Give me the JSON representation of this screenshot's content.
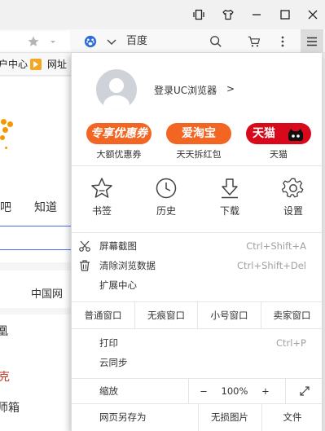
{
  "window_controls": {
    "icons": [
      "page-icon",
      "shirt-icon",
      "minimize-icon",
      "maximize-icon",
      "close-icon"
    ]
  },
  "address_bar": {
    "search_engine": "百度",
    "icons": [
      "star-icon",
      "paw-icon",
      "chevron-down-icon",
      "search-icon",
      "cart-icon",
      "more-icon",
      "menu-icon"
    ]
  },
  "bookmarks": {
    "items": [
      "户中心",
      "网址"
    ]
  },
  "page": {
    "fragments": [
      "吧",
      "知道",
      "中国网",
      "凰",
      "克",
      "师箱"
    ]
  },
  "menu": {
    "login_text": "登录UC浏览器",
    "login_arrow": ">",
    "promos": [
      {
        "pill": "专享优惠券",
        "label": "大额优惠券",
        "color": "#f26522"
      },
      {
        "pill": "爱淘宝",
        "label": "天天拆红包",
        "color": "#f26522"
      },
      {
        "pill": "天猫",
        "label": "天猫",
        "color": "#d8091b"
      }
    ],
    "quick": [
      {
        "label": "书签",
        "icon": "star-outline-icon"
      },
      {
        "label": "历史",
        "icon": "clock-icon"
      },
      {
        "label": "下载",
        "icon": "download-icon"
      },
      {
        "label": "设置",
        "icon": "gear-icon"
      }
    ],
    "tools": [
      {
        "label": "屏幕截图",
        "shortcut": "Ctrl+Shift+A",
        "icon": "scissors-icon"
      },
      {
        "label": "清除浏览数据",
        "shortcut": "Ctrl+Shift+Del",
        "icon": "trash-icon"
      },
      {
        "label": "扩展中心",
        "shortcut": "",
        "icon": ""
      }
    ],
    "windows": [
      "普通窗口",
      "无痕窗口",
      "小号窗口",
      "卖家窗口"
    ],
    "print": {
      "label": "打印",
      "shortcut": "Ctrl+P"
    },
    "sync": {
      "label": "云同步"
    },
    "zoom": {
      "label": "缩放",
      "minus": "−",
      "value": "100%",
      "plus": "+"
    },
    "save": {
      "label": "网页另存为",
      "no_images": "无损图片",
      "file": "文件"
    }
  }
}
